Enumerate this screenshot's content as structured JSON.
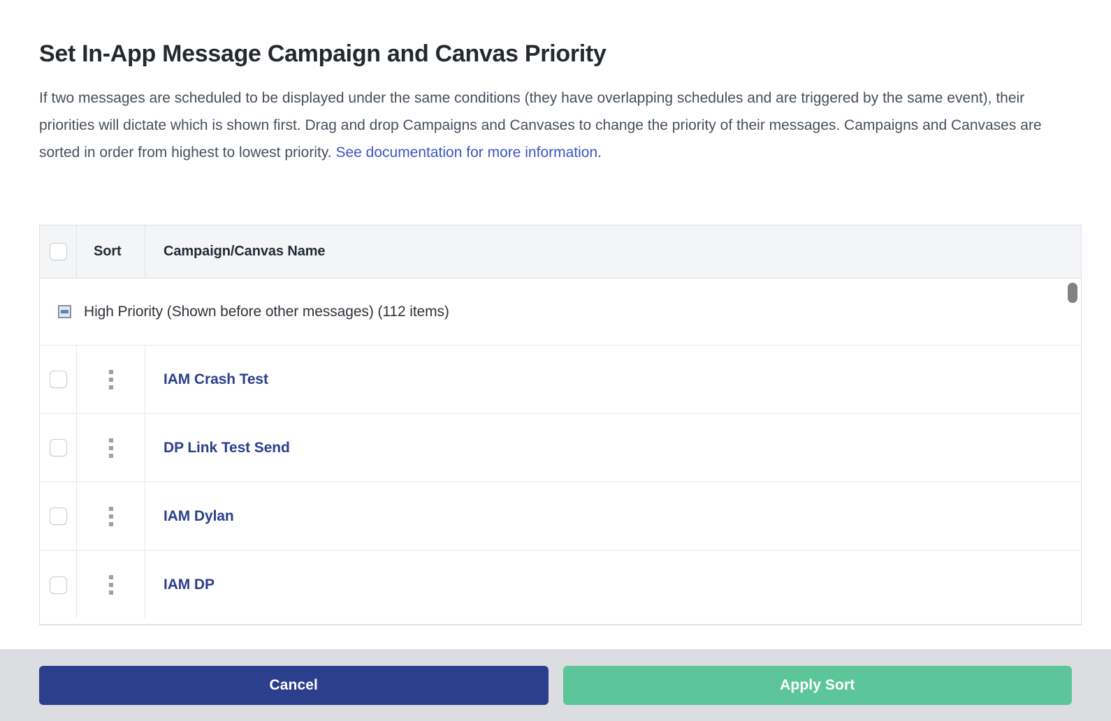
{
  "header": {
    "title": "Set In-App Message Campaign and Canvas Priority",
    "description_part1": "If two messages are scheduled to be displayed under the same conditions (they have overlapping schedules and are triggered by the same event), their priorities will dictate which is shown first. Drag and drop Campaigns and Canvases to change the priority of their messages. Campaigns and Canvases are sorted in order from highest to lowest priority. ",
    "link_text": "See documentation for more information",
    "description_end": "."
  },
  "table": {
    "columns": {
      "select_all": "",
      "sort": "Sort",
      "name": "Campaign/Canvas Name"
    },
    "group": {
      "label": "High Priority (Shown before other messages) (112 items)",
      "collapse_icon": "minus-square-icon",
      "expanded": true
    },
    "rows": [
      {
        "name": "IAM Crash Test",
        "drag_icon": "drag-handle-icon",
        "checked": false
      },
      {
        "name": "DP Link Test Send",
        "drag_icon": "drag-handle-icon",
        "checked": false
      },
      {
        "name": "IAM Dylan",
        "drag_icon": "drag-handle-icon",
        "checked": false
      },
      {
        "name": "IAM DP",
        "drag_icon": "drag-handle-icon",
        "checked": false
      }
    ]
  },
  "footer": {
    "cancel_label": "Cancel",
    "apply_label": "Apply Sort"
  },
  "colors": {
    "link": "#3a56c4",
    "row_name": "#2b3f8c",
    "cancel_bg": "#2b3f8c",
    "apply_bg": "#5cc69a",
    "footer_bg": "#dcdde1",
    "header_bg": "#f4f5f7",
    "border": "#dfe1e6"
  }
}
